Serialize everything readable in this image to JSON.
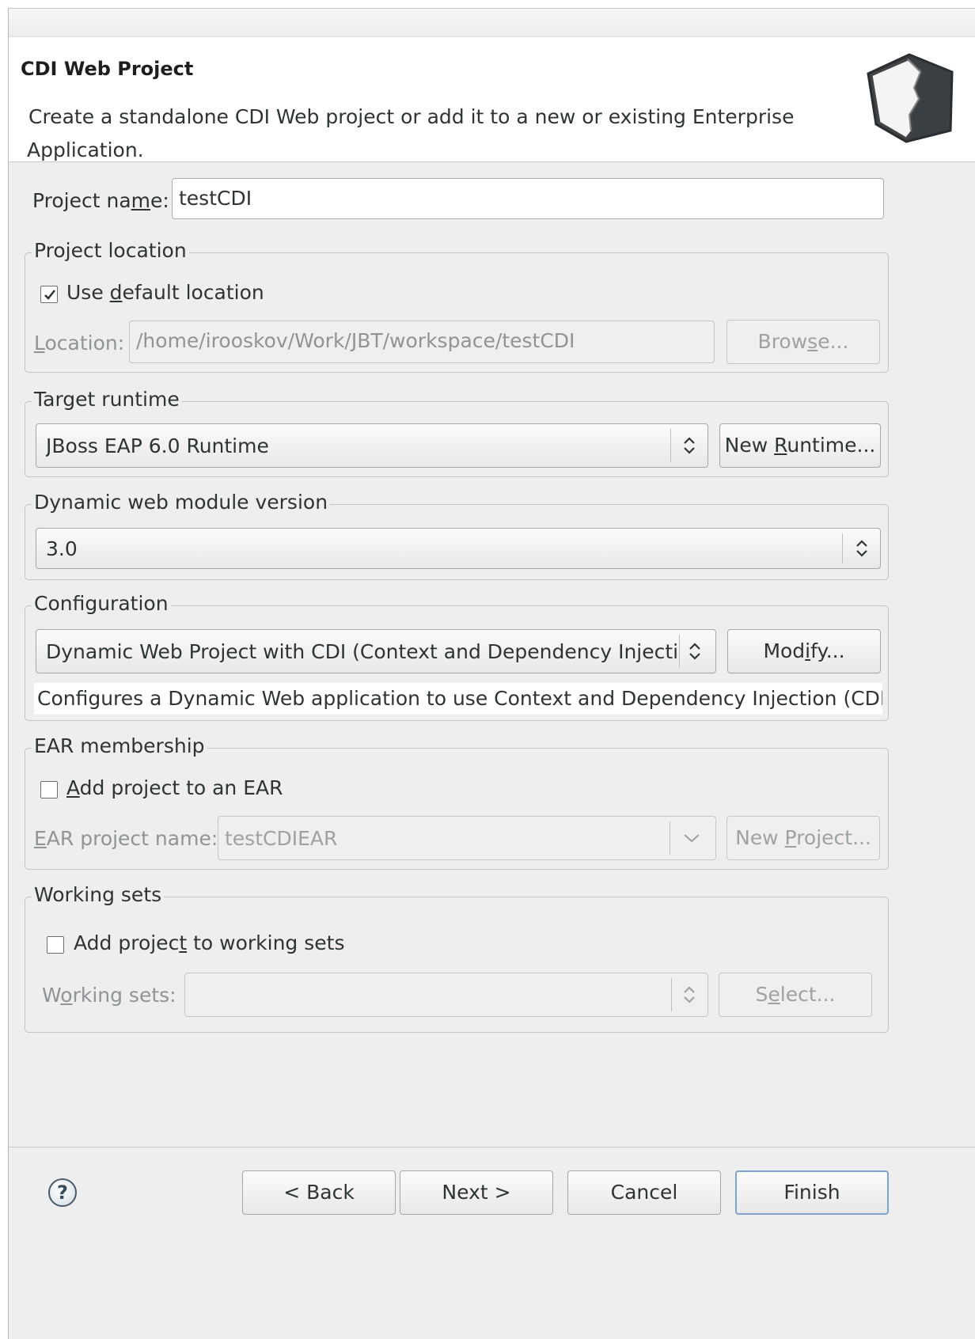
{
  "header": {
    "title": "CDI Web Project",
    "description_line1": "Create a standalone CDI Web project or add it to a new or existing Enterprise",
    "description_line2": "Application."
  },
  "project_name": {
    "label_pre": "Project na",
    "label_u": "m",
    "label_post": "e:",
    "value": "testCDI"
  },
  "project_location": {
    "group_label": "Project location",
    "use_default": {
      "label_pre": "Use ",
      "label_u": "d",
      "label_post": "efault location",
      "checked": true
    },
    "location": {
      "label_u": "L",
      "label_post": "ocation:",
      "value": "/home/irooskov/Work/JBT/workspace/testCDI"
    },
    "browse": {
      "label_pre": "Brow",
      "label_u": "s",
      "label_post": "e..."
    }
  },
  "target_runtime": {
    "group_label": "Target runtime",
    "selected": "JBoss EAP 6.0 Runtime",
    "new_runtime": {
      "label_pre": "New ",
      "label_u": "R",
      "label_post": "untime..."
    }
  },
  "web_module": {
    "group_label": "Dynamic web module version",
    "selected": "3.0"
  },
  "configuration": {
    "group_label": "Configuration",
    "selected": "Dynamic Web Project with CDI (Context and Dependency Injectio",
    "modify": {
      "label_pre": "Mod",
      "label_u": "i",
      "label_post": "fy..."
    },
    "description": "Configures a Dynamic Web application to use Context and Dependency Injection (CDI)"
  },
  "ear": {
    "group_label": "EAR membership",
    "add": {
      "label_u": "A",
      "label_post": "dd project to an EAR",
      "checked": false
    },
    "name": {
      "label_u": "E",
      "label_post": "AR project name:",
      "value": "testCDIEAR"
    },
    "new_project": {
      "label_pre": "New ",
      "label_u": "P",
      "label_post": "roject..."
    }
  },
  "working_sets": {
    "group_label": "Working sets",
    "add": {
      "label_pre": "Add projec",
      "label_u": "t",
      "label_post": " to working sets",
      "checked": false
    },
    "label": {
      "label_pre": "W",
      "label_u": "o",
      "label_post": "rking sets:"
    },
    "value": "",
    "select": {
      "label_pre": "S",
      "label_u": "e",
      "label_post": "lect..."
    }
  },
  "footer": {
    "help": "?",
    "back": "< Back",
    "next": "Next >",
    "cancel": "Cancel",
    "finish": "Finish"
  }
}
